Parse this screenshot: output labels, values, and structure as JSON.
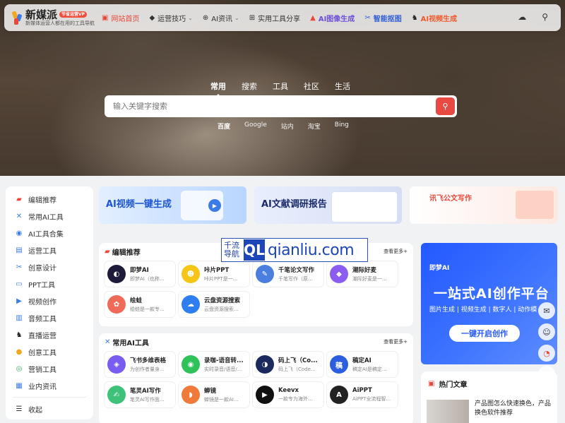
{
  "header": {
    "logo_title": "新媒派",
    "logo_badge": "节省运营VP",
    "logo_subtitle": "新媒体运营人都在用的工具导航",
    "nav": [
      {
        "label": "网站首页",
        "icon": "fire-icon",
        "active": true
      },
      {
        "label": "运营技巧",
        "icon": "tag-icon",
        "caret": true
      },
      {
        "label": "AI资讯",
        "icon": "globe-icon",
        "caret": true
      },
      {
        "label": "实用工具分享",
        "icon": "windows-icon"
      },
      {
        "label": "AI图像生成",
        "icon": "image-gen-icon"
      },
      {
        "label": "智能抠图",
        "icon": "cutout-icon"
      },
      {
        "label": "AI视频生成",
        "icon": "video-gen-icon"
      }
    ]
  },
  "search": {
    "tabs": [
      "常用",
      "搜索",
      "工具",
      "社区",
      "生活"
    ],
    "placeholder": "输入关键字搜索",
    "engines": [
      "百度",
      "Google",
      "站内",
      "淘宝",
      "Bing"
    ]
  },
  "sidebar": {
    "items": [
      {
        "label": "编辑推荐",
        "icon": "hot-icon",
        "color": "#e8483a"
      },
      {
        "label": "常用AI工具",
        "icon": "tools-icon",
        "color": "#3a7be8"
      },
      {
        "label": "AI工具合集",
        "icon": "ai-icon",
        "color": "#3a7be8"
      },
      {
        "label": "运营工具",
        "icon": "chart-icon",
        "color": "#3a7be8"
      },
      {
        "label": "创意设计",
        "icon": "design-icon",
        "color": "#3a7be8"
      },
      {
        "label": "PPT工具",
        "icon": "ppt-icon",
        "color": "#3a7be8"
      },
      {
        "label": "视频创作",
        "icon": "video-icon",
        "color": "#3a7be8"
      },
      {
        "label": "音频工具",
        "icon": "audio-icon",
        "color": "#3a7be8"
      },
      {
        "label": "直播运营",
        "icon": "live-icon",
        "color": "#3a7be8"
      },
      {
        "label": "创意工具",
        "icon": "bulb-icon",
        "color": "#f2a81c"
      },
      {
        "label": "营销工具",
        "icon": "marketing-icon",
        "color": "#3a7be8"
      },
      {
        "label": "业内资讯",
        "icon": "news-icon",
        "color": "#3a7be8"
      }
    ],
    "collapse_label": "收起"
  },
  "banners": [
    {
      "title": "AI视频一键生成"
    },
    {
      "title": "AI文献调研报告"
    },
    {
      "title": "讯飞公文写作"
    }
  ],
  "editor_section": {
    "title": "编辑推荐",
    "more": "查看更多+",
    "cards": [
      {
        "name": "即梦AI",
        "desc": "即梦AI（也称...",
        "color": "#1e1b3a",
        "glyph": "◐"
      },
      {
        "name": "咔片PPT",
        "desc": "咔片PPT是一...",
        "color": "#f5c518",
        "glyph": "☻"
      },
      {
        "name": "千笔论文写作",
        "desc": "千笔写作（原...",
        "color": "#4a7fe0",
        "glyph": "✎"
      },
      {
        "name": "潮际好麦",
        "desc": "潮际好麦是一...",
        "color": "#8a5cf0",
        "glyph": "◆"
      },
      {
        "name": "绘蛙",
        "desc": "绘蛙是一款专...",
        "color": "#f06a5a",
        "glyph": "✿"
      },
      {
        "name": "云盘资源搜索",
        "desc": "云盘资源搜索...",
        "color": "#2f7ef0",
        "glyph": "☁"
      }
    ]
  },
  "ai_section": {
    "title": "常用AI工具",
    "more": "查看更多+",
    "cards": [
      {
        "name": "飞书多维表格",
        "desc": "为创作者量身...",
        "color": "#7b5cf0",
        "glyph": "◈"
      },
      {
        "name": "录咖-语音转...",
        "desc": "实时录音/语音/...",
        "color": "#2ec25a",
        "glyph": "◉"
      },
      {
        "name": "码上飞（Co...",
        "desc": "码上飞（Code...",
        "color": "#1a2a5c",
        "glyph": "◑"
      },
      {
        "name": "稿定AI",
        "desc": "稿定AI是稿定...",
        "color": "#2b5fe0",
        "glyph": "稿"
      },
      {
        "name": "笔灵AI写作",
        "desc": "笔灵AI写作面...",
        "color": "#3ec27a",
        "glyph": "✍"
      },
      {
        "name": "蝉镜",
        "desc": "蝉镜是一款AI...",
        "color": "#f07a3a",
        "glyph": "◗"
      },
      {
        "name": "Keevx",
        "desc": "一款专为海外...",
        "color": "#111111",
        "glyph": "▶"
      },
      {
        "name": "AiPPT",
        "desc": "AiPPT全流程智...",
        "color": "#222222",
        "glyph": "A"
      }
    ]
  },
  "watermark": {
    "cn": "千流导航",
    "ql": "QL",
    "domain": "qianliu.com"
  },
  "ad": {
    "logo": "即梦AI",
    "title": "一站式AI创作平台",
    "subtitle": "图片生成 | 视频生成 | 数字人 | 动作模",
    "button": "一键开启创作"
  },
  "hot": {
    "title": "热门文章",
    "article": "产品图怎么快速换色，产品换色软件推荐"
  }
}
